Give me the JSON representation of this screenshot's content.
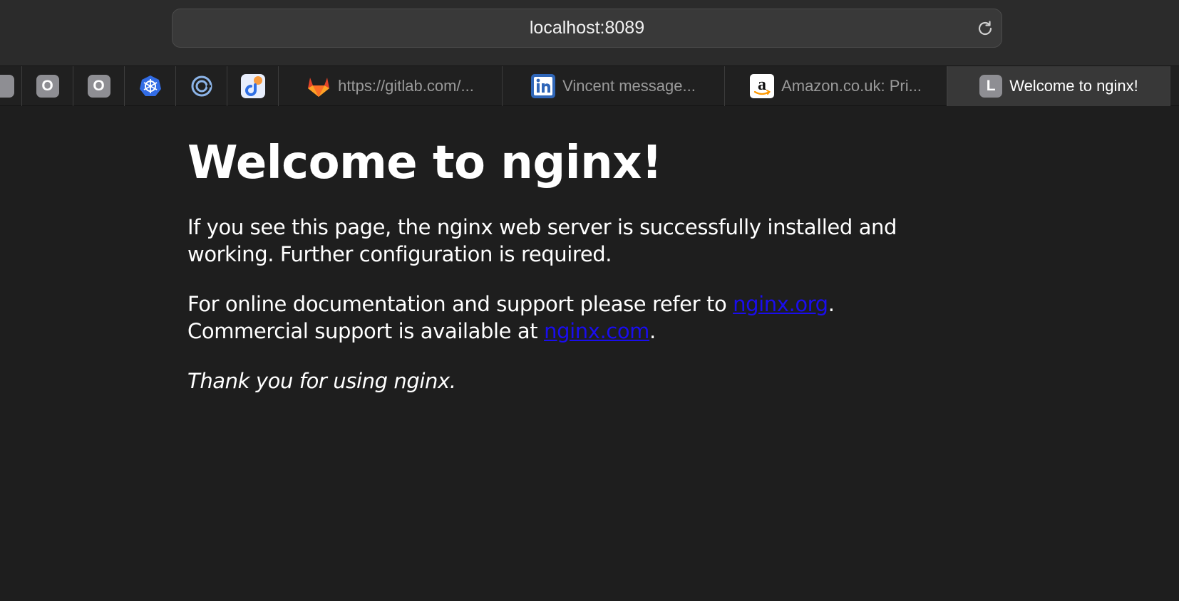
{
  "browser": {
    "url": "localhost:8089",
    "pinned_tabs": [
      {
        "icon": "openai-icon",
        "letter": "O"
      },
      {
        "icon": "openai-icon",
        "letter": "O"
      },
      {
        "icon": "kubernetes-icon"
      },
      {
        "icon": "swirl-app-icon"
      },
      {
        "icon": "jira-like-app-icon"
      }
    ],
    "tabs": [
      {
        "label": "https://gitlab.com/...",
        "icon": "gitlab-icon"
      },
      {
        "label": "Vincent message...",
        "icon": "linkedin-icon"
      },
      {
        "label": "Amazon.co.uk: Pri...",
        "icon": "amazon-icon"
      },
      {
        "label": "Welcome to nginx!",
        "icon": "letter-l-icon",
        "letter": "L",
        "active": true
      }
    ]
  },
  "page": {
    "heading": "Welcome to nginx!",
    "para1_line1": "If you see this page, the nginx web server is successfully installed and",
    "para1_line2": "working. Further configuration is required.",
    "para2_line1_before": "For online documentation and support please refer to ",
    "para2_link1": "nginx.org",
    "para2_line1_after": ".",
    "para2_line2_before": "Commercial support is available at ",
    "para2_link2": "nginx.com",
    "para2_line2_after": ".",
    "thanks": "Thank you for using nginx."
  },
  "colors": {
    "background": "#1e1e1e",
    "link": "#1a0dee",
    "text": "#ffffff"
  }
}
